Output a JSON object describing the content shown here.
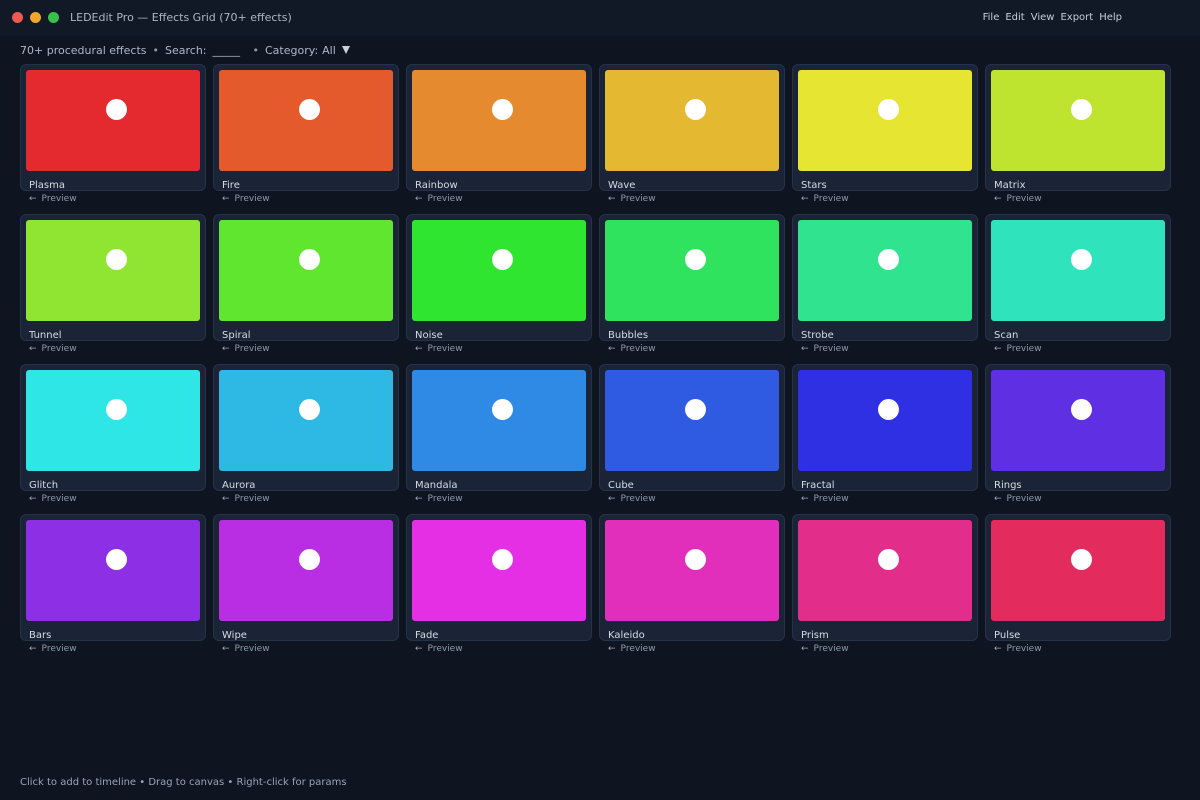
{
  "window": {
    "title": "LEDEdit Pro — Effects Grid (70+ effects)",
    "menu": [
      "File",
      "Edit",
      "View",
      "Export",
      "Help"
    ]
  },
  "toolbar": {
    "count_text": "70+ procedural effects",
    "separator": "•",
    "search_label": "Search:",
    "search_value": "_____",
    "category_label": "Category:",
    "category_value": "All"
  },
  "effects": [
    {
      "name": "Plasma",
      "color": "#e52a2f"
    },
    {
      "name": "Fire",
      "color": "#e45a2d"
    },
    {
      "name": "Rainbow",
      "color": "#e58a2e"
    },
    {
      "name": "Wave",
      "color": "#e4b831"
    },
    {
      "name": "Stars",
      "color": "#e6e531"
    },
    {
      "name": "Matrix",
      "color": "#bee42f"
    },
    {
      "name": "Tunnel",
      "color": "#8fe532"
    },
    {
      "name": "Spiral",
      "color": "#60e62e"
    },
    {
      "name": "Noise",
      "color": "#2fe52f"
    },
    {
      "name": "Bubbles",
      "color": "#2fe35e"
    },
    {
      "name": "Strobe",
      "color": "#2fe38f"
    },
    {
      "name": "Scan",
      "color": "#2fe3bd"
    },
    {
      "name": "Glitch",
      "color": "#2ee6e6"
    },
    {
      "name": "Aurora",
      "color": "#2eb8e4"
    },
    {
      "name": "Mandala",
      "color": "#2e8ae4"
    },
    {
      "name": "Cube",
      "color": "#2f5be2"
    },
    {
      "name": "Fractal",
      "color": "#2f2fe3"
    },
    {
      "name": "Rings",
      "color": "#5e2fe3"
    },
    {
      "name": "Bars",
      "color": "#8c2fe5"
    },
    {
      "name": "Wipe",
      "color": "#b92ee3"
    },
    {
      "name": "Fade",
      "color": "#e42fe5"
    },
    {
      "name": "Kaleido",
      "color": "#e22fbb"
    },
    {
      "name": "Prism",
      "color": "#e22d8b"
    },
    {
      "name": "Pulse",
      "color": "#e32c5d"
    }
  ],
  "card": {
    "preview_label": "Preview",
    "preview_icon": "arrow-left-icon"
  },
  "footer": {
    "hint": "Click to add to timeline  •  Drag to canvas  •  Right-click for params"
  }
}
